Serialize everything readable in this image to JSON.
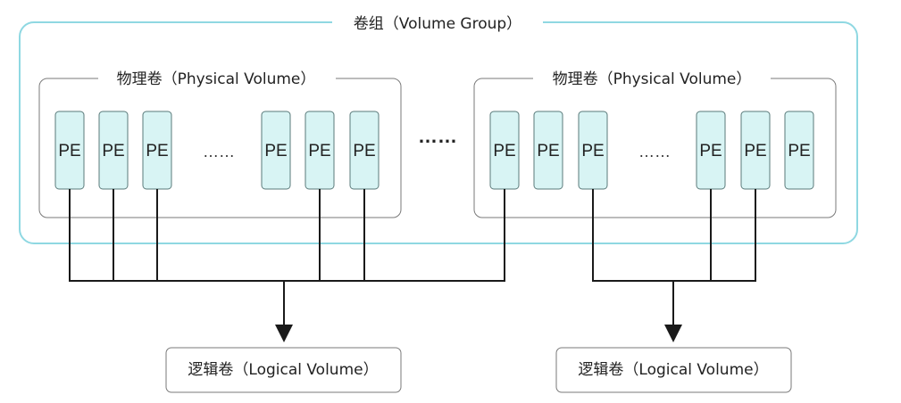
{
  "volume_group": {
    "label": "卷组（Volume Group）"
  },
  "physical_volumes": [
    {
      "label": "物理卷（Physical Volume）",
      "extent_label": "PE",
      "ellipsis": "……"
    },
    {
      "label": "物理卷（Physical Volume）",
      "extent_label": "PE",
      "ellipsis": "……"
    }
  ],
  "between_volumes_ellipsis": "……",
  "logical_volumes": [
    {
      "label": "逻辑卷（Logical Volume）"
    },
    {
      "label": "逻辑卷（Logical Volume）"
    }
  ],
  "colors": {
    "pe_fill": "#d8f4f4",
    "volume_group_border": "#8fd8e2",
    "wire": "#1a1a1a"
  }
}
